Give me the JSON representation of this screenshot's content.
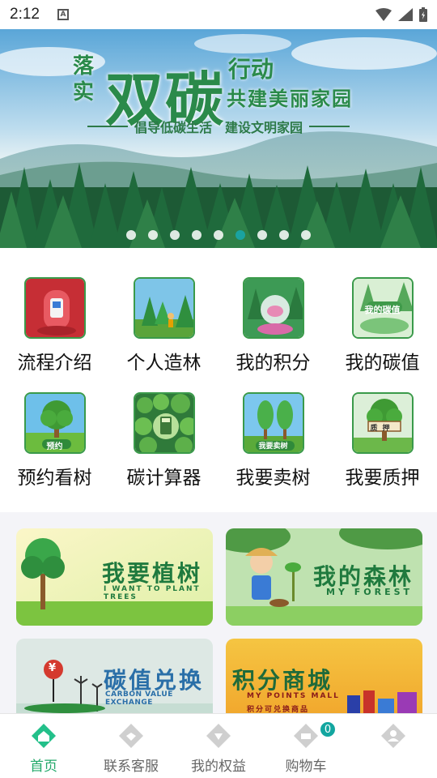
{
  "status_bar": {
    "time": "2:12",
    "notification_glyph": "A"
  },
  "banner": {
    "pre_title": "落实",
    "main_title": "双碳",
    "title_right_1": "行动",
    "title_right_2": "共建美丽家园",
    "slogan": "倡导低碳生活　建设文明家园",
    "dot_count": 9,
    "active_dot_index": 5
  },
  "menu": {
    "items": [
      {
        "label": "流程介绍",
        "icon": "process-icon"
      },
      {
        "label": "个人造林",
        "icon": "afforestation-icon"
      },
      {
        "label": "我的积分",
        "icon": "points-icon"
      },
      {
        "label": "我的碳值",
        "icon": "carbon-value-icon",
        "icon_text": "我的碳值"
      },
      {
        "label": "预约看树",
        "icon": "reserve-tree-icon",
        "icon_text": "预约"
      },
      {
        "label": "碳计算器",
        "icon": "carbon-calculator-icon"
      },
      {
        "label": "我要卖树",
        "icon": "sell-tree-icon",
        "icon_text": "我要卖树"
      },
      {
        "label": "我要质押",
        "icon": "pledge-icon",
        "icon_text": "质押"
      }
    ]
  },
  "cards": [
    {
      "title": "我要植树",
      "subtitle": "I WANT TO PLANT TREES"
    },
    {
      "title": "我的森林",
      "subtitle": "MY FOREST"
    },
    {
      "title": "碳值兑换",
      "subtitle": "CARBON VALUE EXCHANGE"
    },
    {
      "title": "积分商城",
      "subtitle": "MY POINTS MALL",
      "subtitle_2": "积分可兑换商品"
    }
  ],
  "tabbar": {
    "tabs": [
      {
        "label": "首页",
        "icon": "home-icon",
        "active": true
      },
      {
        "label": "联系客服",
        "icon": "customer-service-icon",
        "active": false
      },
      {
        "label": "我的权益",
        "icon": "benefits-icon",
        "active": false
      },
      {
        "label": "购物车",
        "icon": "cart-icon",
        "active": false,
        "badge": "0"
      },
      {
        "label": "",
        "icon": "profile-icon",
        "active": false
      }
    ]
  },
  "colors": {
    "accent": "#23a86a",
    "brand_green": "#2a8a4a",
    "badge": "#13a6a0"
  }
}
